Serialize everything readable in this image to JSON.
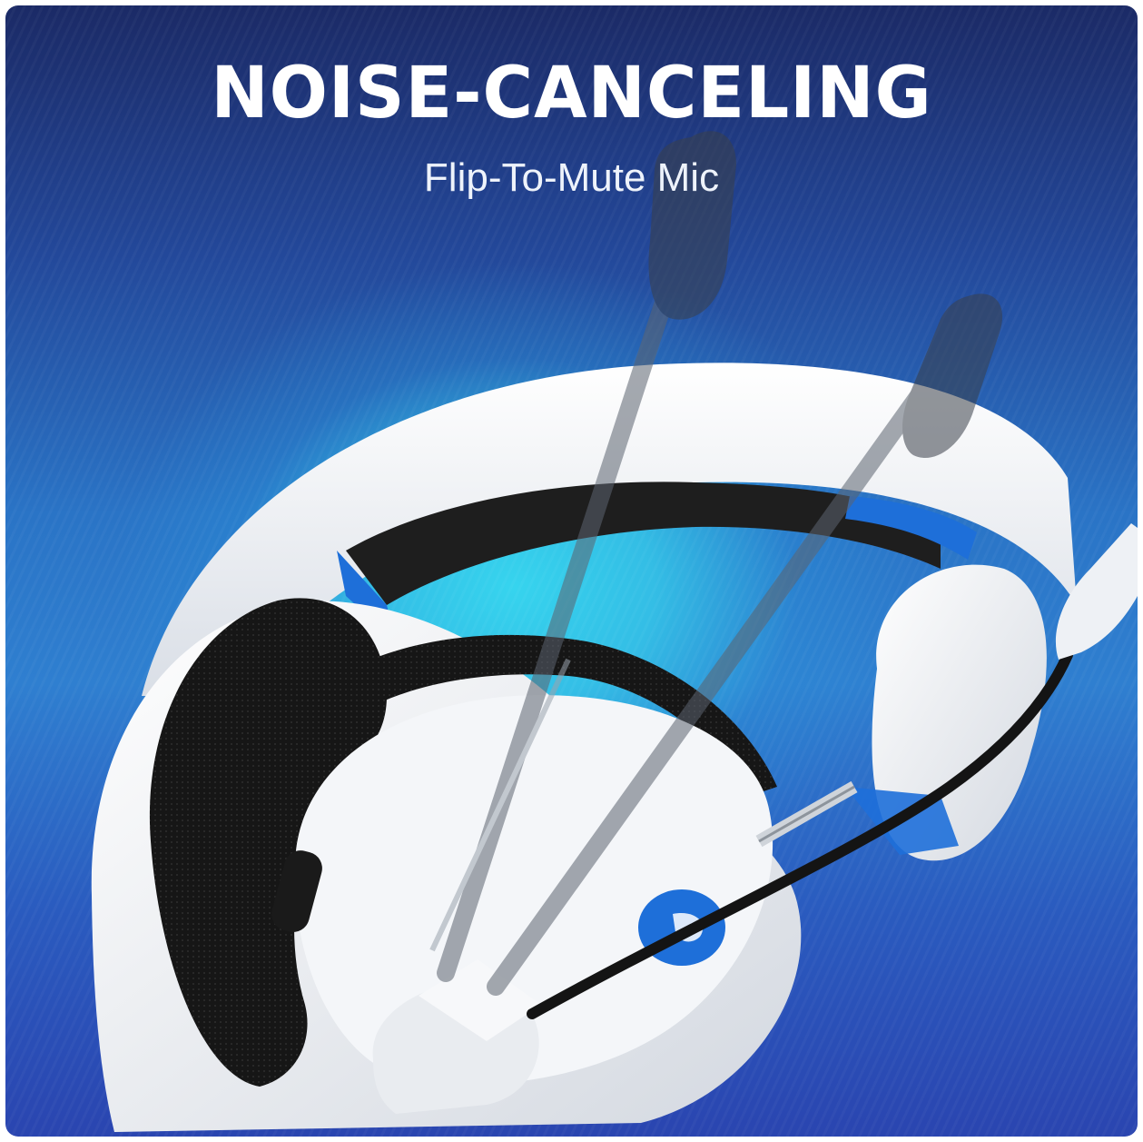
{
  "hero": {
    "headline": "NOISE-CANCELING",
    "subheadline": "Flip-To-Mute Mic"
  },
  "image": {
    "subject": "white-gaming-headset-icon",
    "colors": {
      "background_dark": "#1b2a66",
      "background_glow": "#36d4ee",
      "headset_white": "#f2f4f7",
      "accent_blue": "#1e6fd9",
      "ear_cushion": "#141414"
    }
  }
}
